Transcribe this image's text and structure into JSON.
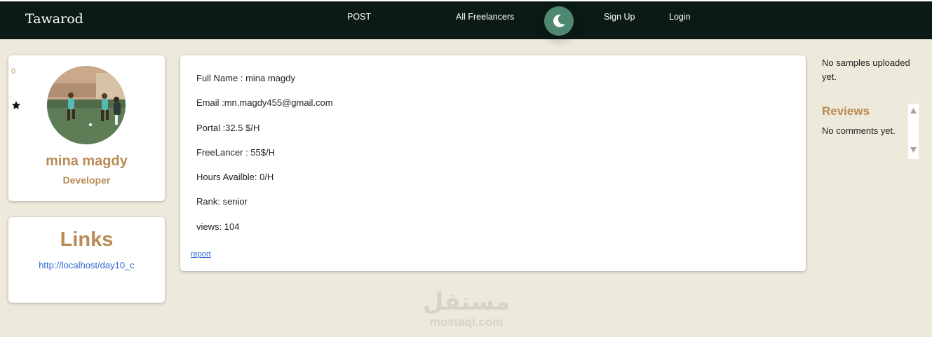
{
  "navbar": {
    "brand": "Tawarod",
    "links": [
      "POST",
      "All Freelancers",
      "Sign Up",
      "Login"
    ],
    "theme_icon": "moon-icon"
  },
  "profile": {
    "rating_count": "0",
    "rating_icon": "star-icon",
    "name": "mina magdy",
    "role": "Developer"
  },
  "links": {
    "title": "Links",
    "url_text": "http://localhost/day10_c"
  },
  "info": {
    "rows": [
      "Full Name : mina magdy",
      "Email :mn.magdy455@gmail.com",
      "Portal :32.5 $/H",
      "FreeLancer : 55$/H",
      "Hours Availble: 0/H",
      "Rank: senior",
      "views: 104"
    ],
    "report": "report"
  },
  "sidebar": {
    "samples": "No samples uploaded yet.",
    "reviews_title": "Reviews",
    "comments": "No comments yet."
  },
  "watermark": {
    "arabic": "مستقل",
    "latin": "mostaql.com"
  },
  "colors": {
    "navbar": "#0b1a16",
    "page_bg": "#ede9db",
    "accent": "#b98a54",
    "toggle": "#4f8870",
    "link": "#2a67d1"
  }
}
